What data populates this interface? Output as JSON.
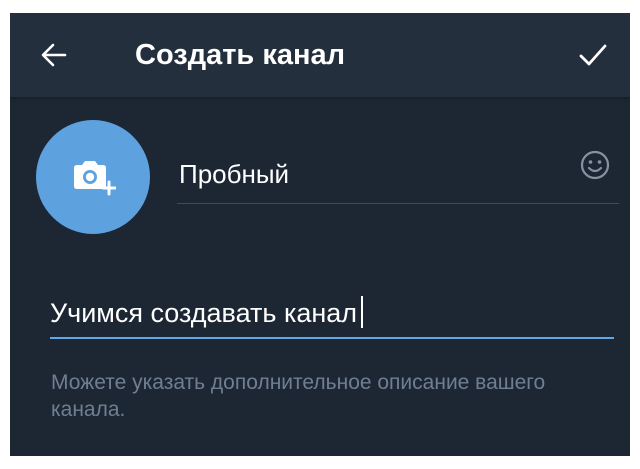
{
  "header": {
    "back_icon": "arrow-left-icon",
    "title": "Создать канал",
    "done_icon": "checkmark-icon"
  },
  "channel": {
    "avatar_icon": "camera-add-icon",
    "name_value": "Пробный",
    "emoji_icon": "smiley-face-icon"
  },
  "description": {
    "value": "Учимся создавать канал",
    "hint": "Можете указать дополнительное описание вашего канала."
  },
  "colors": {
    "background": "#1d2733",
    "header_background": "#242f3d",
    "accent": "#5ea1df",
    "hint_text": "#6f7f92"
  }
}
